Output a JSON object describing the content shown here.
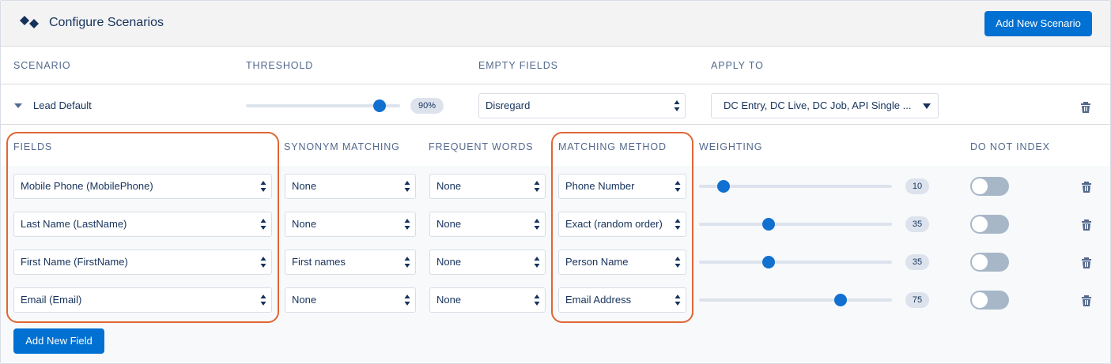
{
  "header": {
    "title": "Configure Scenarios",
    "add_scenario_label": "Add New Scenario"
  },
  "columns": {
    "scenario": "SCENARIO",
    "threshold": "THRESHOLD",
    "empty_fields": "EMPTY FIELDS",
    "apply_to": "APPLY TO"
  },
  "scenario": {
    "name": "Lead Default",
    "threshold": 0.9,
    "threshold_label": "90%",
    "empty_fields": "Disregard",
    "apply_to": "DC Entry, DC Live, DC Job, API Single ..."
  },
  "field_columns": {
    "fields": "FIELDS",
    "synonym": "SYNONYM MATCHING",
    "frequent": "FREQUENT WORDS",
    "method": "MATCHING METHOD",
    "weighting": "WEIGHTING",
    "no_index": "DO NOT INDEX"
  },
  "rows": [
    {
      "field": "Mobile Phone (MobilePhone)",
      "synonym": "None",
      "frequent": "None",
      "method": "Phone Number",
      "weight": 10,
      "weight_label": "10",
      "no_index": false
    },
    {
      "field": "Last Name (LastName)",
      "synonym": "None",
      "frequent": "None",
      "method": "Exact (random order)",
      "weight": 35,
      "weight_label": "35",
      "no_index": false
    },
    {
      "field": "First Name (FirstName)",
      "synonym": "First names",
      "frequent": "None",
      "method": "Person Name",
      "weight": 35,
      "weight_label": "35",
      "no_index": false
    },
    {
      "field": "Email (Email)",
      "synonym": "None",
      "frequent": "None",
      "method": "Email Address",
      "weight": 75,
      "weight_label": "75",
      "no_index": false
    }
  ],
  "add_field_label": "Add New Field",
  "colors": {
    "brand": "#0070d2",
    "highlight": "#e06635",
    "slider_thumb": "#1170d0",
    "toggle_off": "#a8b7c7"
  },
  "icons": [
    "logo-icon",
    "chevron-down-icon",
    "select-arrows-icon",
    "caret-down-icon",
    "trash-icon"
  ]
}
